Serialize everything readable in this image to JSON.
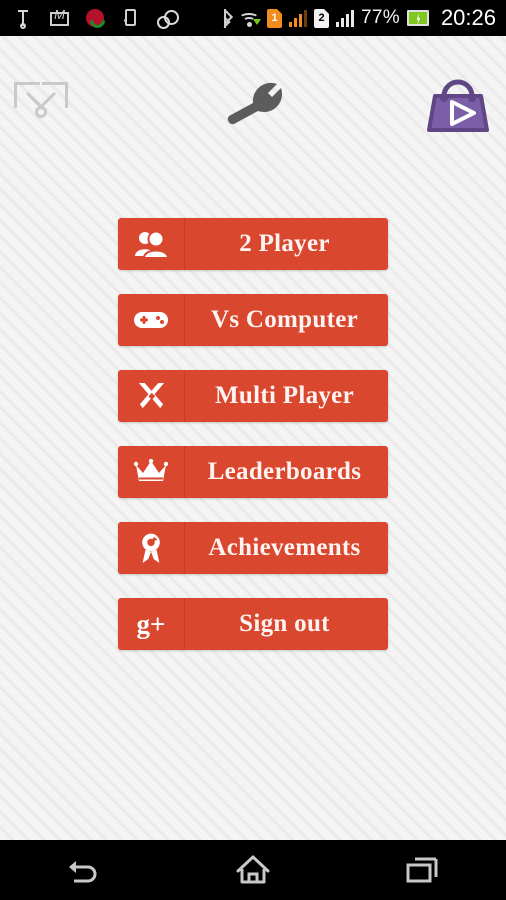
{
  "status_bar": {
    "icons": [
      {
        "name": "usb-icon",
        "label": "USB connected"
      },
      {
        "name": "gmail-icon",
        "label": "Gmail"
      },
      {
        "name": "missed-call-icon",
        "label": "Missed call"
      },
      {
        "name": "device-icon",
        "label": "Device storage"
      },
      {
        "name": "sync-icon",
        "label": "Sync"
      },
      {
        "name": "bluetooth-icon",
        "label": "Bluetooth"
      },
      {
        "name": "wifi-icon",
        "label": "Wi-Fi"
      }
    ],
    "sim1_label": "1",
    "sim2_label": "2",
    "battery_percent": "77%",
    "clock": "20:26",
    "colors": {
      "sim1": "#f08d1c",
      "sim2": "#f2f2f2",
      "battery": "#7ec820",
      "background": "#000000",
      "text": "#ffffff"
    }
  },
  "top_toolbar": {
    "share_icon": "share-icon",
    "settings_icon": "wrench-icon",
    "store_icon": "playstore-bag-icon",
    "colors": {
      "share": "#c9c9c9",
      "wrench": "#5c5c5c",
      "store_bag": "#7b5ea7",
      "store_bag_outline": "#5f4785"
    }
  },
  "menu": {
    "buttons": [
      {
        "label": "2 Player",
        "icon": "two-users-icon"
      },
      {
        "label": "Vs Computer",
        "icon": "gamepad-icon"
      },
      {
        "label": "Multi Player",
        "icon": "crossed-swords-icon"
      },
      {
        "label": "Leaderboards",
        "icon": "crown-icon"
      },
      {
        "label": "Achievements",
        "icon": "award-ribbon-icon"
      },
      {
        "label": "Sign out",
        "icon": "google-plus-icon",
        "icon_text": "g+"
      }
    ],
    "colors": {
      "button": "#d9472f",
      "button_divider": "#c23f29",
      "label_text": "#fdf3f1",
      "page_background": "#f2f2f2",
      "page_stripe": "#eaeaea"
    }
  },
  "nav_bar": {
    "buttons": [
      {
        "label": "Back",
        "icon": "back-arrow-icon"
      },
      {
        "label": "Home",
        "icon": "home-icon"
      },
      {
        "label": "Recent apps",
        "icon": "recent-apps-icon"
      }
    ],
    "color": "#000000"
  }
}
